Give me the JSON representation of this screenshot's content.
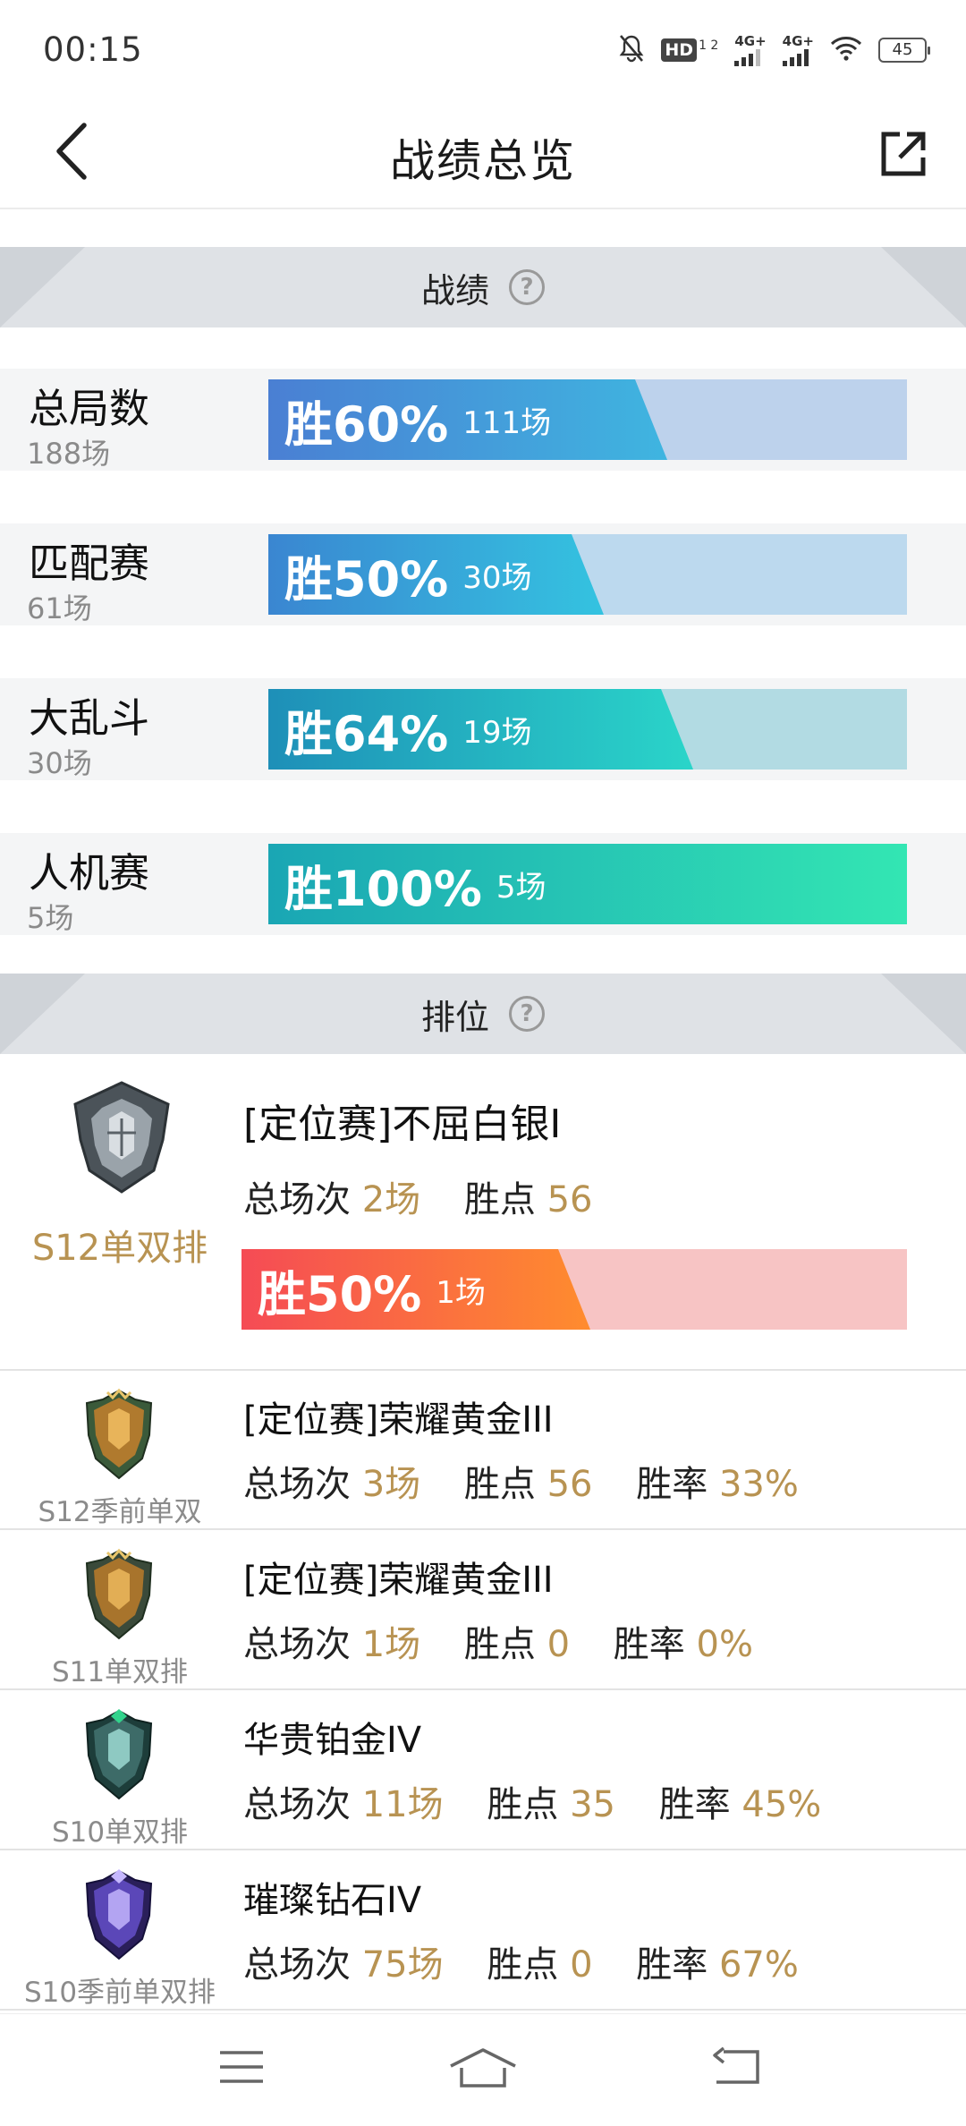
{
  "status_bar": {
    "time": "00:15",
    "hd_label": "HD",
    "hd_sub": "1 2",
    "signal1_label": "4G+",
    "signal2_label": "4G+",
    "battery": "45",
    "icons": [
      "bell-off-icon",
      "hd-icon",
      "signal-icon",
      "signal-icon",
      "wifi-icon",
      "battery-icon"
    ]
  },
  "header": {
    "title": "战绩总览",
    "back_icon": "chevron-left-icon",
    "share_icon": "share-icon"
  },
  "record_section": {
    "title": "战绩",
    "help_glyph": "?",
    "rows": [
      {
        "name": "总局数",
        "count": "188场",
        "win_label": "胜60%",
        "win_games": "111场",
        "win_rate": 0.6,
        "color_from": "#4a7fd3",
        "color_to": "#3fb5e0",
        "track": "#bdd2ec"
      },
      {
        "name": "匹配赛",
        "count": "61场",
        "win_label": "胜50%",
        "win_games": "30场",
        "win_rate": 0.5,
        "color_from": "#3a86d1",
        "color_to": "#34c3e0",
        "track": "#bcd9ee"
      },
      {
        "name": "大乱斗",
        "count": "30场",
        "win_label": "胜64%",
        "win_games": "19场",
        "win_rate": 0.64,
        "color_from": "#1e8fb8",
        "color_to": "#2ad5c9",
        "track": "#b2dbe3"
      },
      {
        "name": "人机赛",
        "count": "5场",
        "win_label": "胜100%",
        "win_games": "5场",
        "win_rate": 1.0,
        "color_from": "#1aa6b4",
        "color_to": "#33e6b3",
        "track": "#b4e6dc"
      }
    ]
  },
  "rank_section": {
    "title": "排位",
    "help_glyph": "?",
    "main": {
      "season": "S12单双排",
      "title": "[定位赛]不屈白银I",
      "total_label": "总场次",
      "total_value": "2场",
      "points_label": "胜点",
      "points_value": "56",
      "win_label": "胜50%",
      "win_games": "1场",
      "win_rate": 0.5,
      "emblem": "silver-rank-emblem-icon"
    },
    "items": [
      {
        "season": "S12季前单双",
        "title": "[定位赛]荣耀黄金III",
        "total_label": "总场次",
        "total_value": "3场",
        "points_label": "胜点",
        "points_value": "56",
        "rate_label": "胜率",
        "rate_value": "33%",
        "emblem": "gold-rank-emblem-icon"
      },
      {
        "season": "S11单双排",
        "title": "[定位赛]荣耀黄金III",
        "total_label": "总场次",
        "total_value": "1场",
        "points_label": "胜点",
        "points_value": "0",
        "rate_label": "胜率",
        "rate_value": "0%",
        "emblem": "gold-rank-emblem-icon"
      },
      {
        "season": "S10单双排",
        "title": "华贵铂金IV",
        "total_label": "总场次",
        "total_value": "11场",
        "points_label": "胜点",
        "points_value": "35",
        "rate_label": "胜率",
        "rate_value": "45%",
        "emblem": "platinum-rank-emblem-icon"
      },
      {
        "season": "S10季前单双排",
        "title": "璀璨钻石IV",
        "total_label": "总场次",
        "total_value": "75场",
        "points_label": "胜点",
        "points_value": "0",
        "rate_label": "胜率",
        "rate_value": "67%",
        "emblem": "diamond-rank-emblem-icon"
      }
    ]
  },
  "nav_bar": {
    "icons": [
      "menu-icon",
      "home-icon",
      "back-icon"
    ]
  }
}
